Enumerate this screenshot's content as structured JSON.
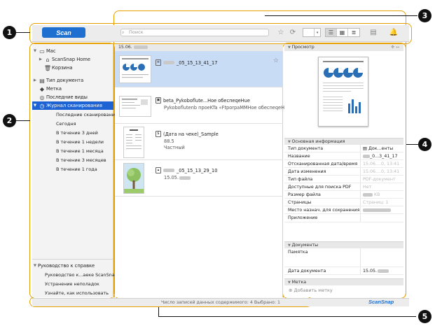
{
  "toolbar": {
    "scan_label": "Scan",
    "search_placeholder": "Поиск"
  },
  "sidebar": {
    "mac": "Mac",
    "scansnap_home": "ScanSnap Home",
    "trash": "Корзина",
    "doc_type": "Тип документа",
    "tag": "Метка",
    "recent_views": "Последние виды",
    "scan_journal": "Журнал сканирования",
    "journal_items": [
      "Последние сканирования",
      "Сегодня",
      "В течение 3 дней",
      "В течение 1 недели",
      "В течение 1 месяца",
      "В течение 3 месяцев",
      "В течение 1 года"
    ],
    "guide_header": "Руководство к справке",
    "guide_items": [
      "Руководство к...аеке ScanSnap",
      "Устранение неполадок",
      "Узнайте, как использовать"
    ]
  },
  "list": {
    "group_date": "15.06.",
    "items": [
      {
        "title": "_05_15_13_41_17",
        "sub": ""
      },
      {
        "title": "beta_Pykoboflute...Hoe обеспеqeHue",
        "sub": "Pykoboflutenb проеKTa «FtporpaMMHoe обеспеqeHue"
      },
      {
        "title": "(Дата на чеке)_Sample",
        "sub": "88.5",
        "sub2": "Частный"
      },
      {
        "title": "_05_15_13_29_10",
        "sub": "15.05."
      }
    ]
  },
  "preview": {
    "header": "Просмотр"
  },
  "basic_info": {
    "header": "Основная информация",
    "rows": [
      {
        "k": "Тип документа",
        "v": "Док...енты"
      },
      {
        "k": "Название",
        "v": "_0...3_41_17"
      },
      {
        "k": "Отсканированная дата/время",
        "v": "15.06....0, 13:41"
      },
      {
        "k": "Дата изменения",
        "v": "15.06....0, 13:41"
      },
      {
        "k": "Тип файла",
        "v": "PDF-документ"
      },
      {
        "k": "Доступные для поиска PDF",
        "v": "Нет"
      },
      {
        "k": "Размер файла",
        "v": "KB"
      },
      {
        "k": "Страницы",
        "v": "Страниц: 1"
      },
      {
        "k": "Место назнач. для сохранения",
        "v": ""
      },
      {
        "k": "Приложение",
        "v": ""
      }
    ]
  },
  "documents": {
    "header": "Документы",
    "memo": "Памятка",
    "doc_date_label": "Дата документа",
    "doc_date_value": "15.05."
  },
  "tag_section": {
    "header": "Метка",
    "add": "Добавить метку"
  },
  "status": {
    "text": "Число записей данных содержимого: 4  Выбрано: 1",
    "brand": "ScanSnap"
  },
  "callouts": [
    "1",
    "2",
    "3",
    "4",
    "5"
  ],
  "colors": {
    "accent": "#1e6fd0",
    "selection": "#1e63d4",
    "frame": "#e6a100"
  }
}
